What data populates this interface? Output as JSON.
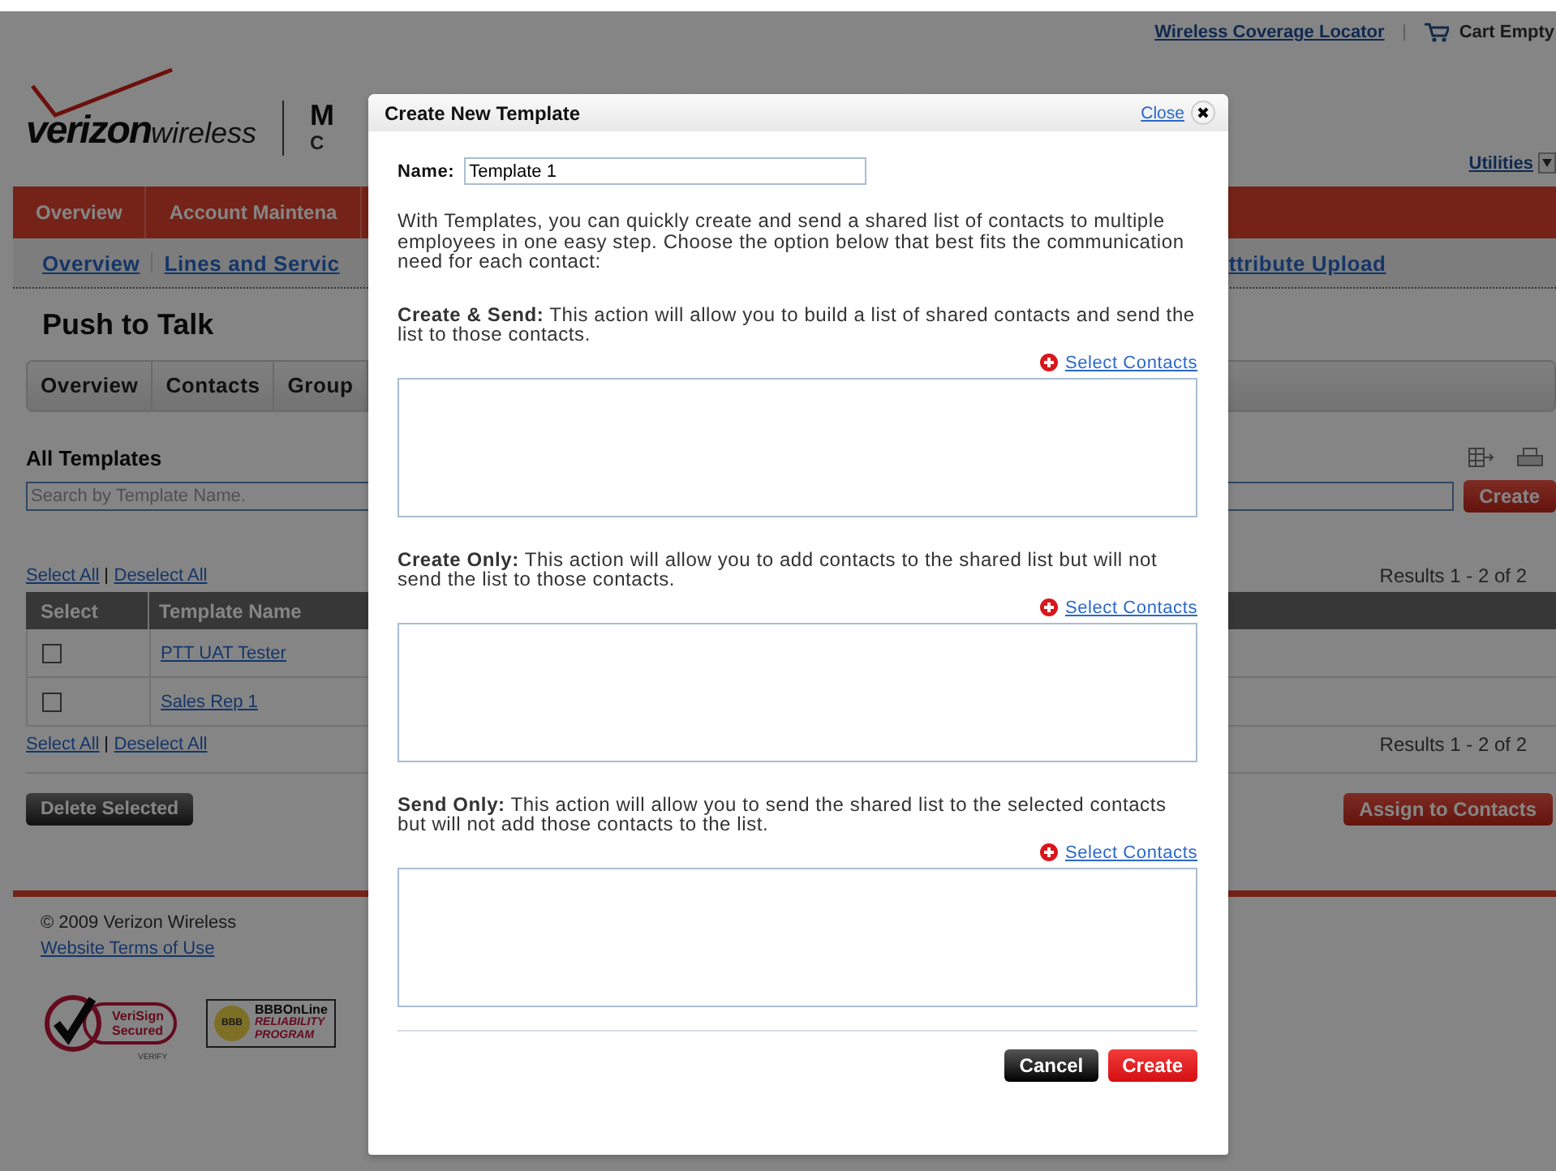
{
  "header": {
    "logo": {
      "bold": "verizon",
      "light": "wireless"
    },
    "title_fragment": "M",
    "subtitle_fragment": "C",
    "links": [
      {
        "label": "Wireless Coverage Locator"
      }
    ],
    "cart": "Cart Empty",
    "utilities": "Utilities"
  },
  "main_nav": [
    "Overview",
    "Account Maintena"
  ],
  "sub_nav": {
    "left": [
      "Overview",
      "Lines and Servic"
    ],
    "right": "ttribute Upload"
  },
  "page_title": "Push to Talk",
  "tabs": [
    "Overview",
    "Contacts",
    "Group"
  ],
  "templates": {
    "title": "All Templates",
    "search": {
      "placeholder": "Search by Template Name."
    },
    "create_button": "Create",
    "select_links": [
      "Select All",
      "Deselect All"
    ],
    "results": "Results 1 - 2 of 2",
    "columns": [
      "Select",
      "Template Name"
    ],
    "rows": [
      {
        "name": "PTT UAT Tester",
        "checked": false
      },
      {
        "name": "Sales Rep 1",
        "checked": false
      }
    ],
    "select_links_bottom": [
      "Select All",
      "Deselect All"
    ],
    "results_bottom": "Results 1 - 2 of 2",
    "delete_button": "Delete Selected",
    "assign_button": "Assign to Contacts"
  },
  "footer": {
    "copyright": "© 2009 Verizon Wireless",
    "terms": "Website Terms of Use",
    "verisign": [
      "VeriSign",
      "Secured",
      "VERIFY"
    ],
    "bbb": {
      "seal": "BBB",
      "lines": [
        "BBBOnLine",
        "RELIABILITY",
        "PROGRAM"
      ]
    }
  },
  "modal": {
    "title": "Create New Template",
    "close": "Close",
    "name_label": "Name:",
    "name_value": "Template 1",
    "intro": "With Templates, you can quickly create and send a shared list of contacts to multiple employees in one easy step. Choose the option below that best fits the communication need for each contact:",
    "sections": [
      {
        "text": "**Create & Send:** This action will allow you to build a list of shared contacts and send the list to those contacts.",
        "link": "Select Contacts"
      },
      {
        "text": "**Create Only:** This action will allow you to add contacts to the shared list but will not send the list to those contacts.",
        "link": "Select Contacts"
      },
      {
        "text": "**Send Only:** This action will allow you to send the shared list to the selected contacts but will not add those contacts to the list.",
        "link": "Select Contacts"
      }
    ],
    "buttons": [
      {
        "label": "Cancel",
        "kind": "secondary"
      },
      {
        "label": "Create",
        "kind": "primary"
      }
    ]
  }
}
